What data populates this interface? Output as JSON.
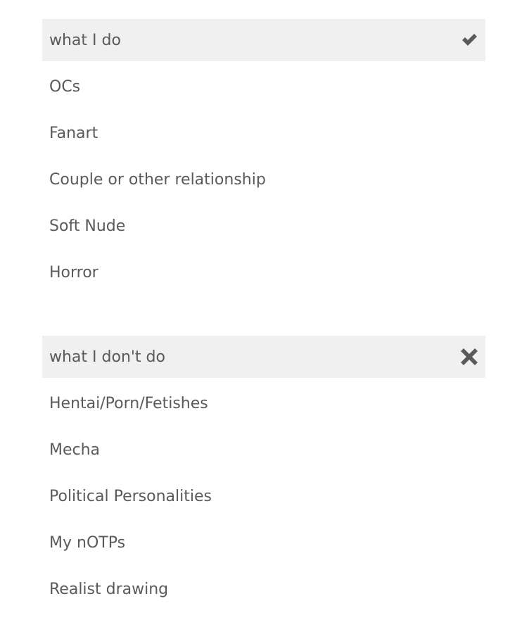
{
  "sections": {
    "do": {
      "title": "what I do",
      "icon": "checkmark-icon",
      "items": [
        "OCs",
        "Fanart",
        "Couple or other relationship",
        "Soft Nude",
        "Horror"
      ]
    },
    "dont": {
      "title": "what I don't do",
      "icon": "x-mark-icon",
      "items": [
        "Hentai/Porn/Fetishes",
        "Mecha",
        "Political Personalities",
        "My nOTPs",
        "Realist drawing"
      ]
    }
  },
  "colors": {
    "header_bg": "#f0f0f0",
    "text": "#5a5a5a",
    "icon": "#5a5a5a"
  }
}
